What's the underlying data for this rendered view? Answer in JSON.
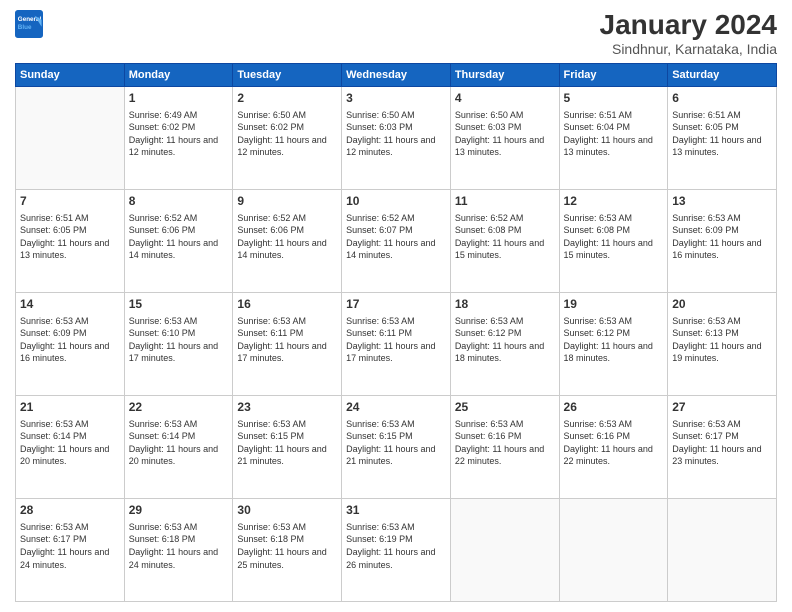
{
  "logo": {
    "line1": "General",
    "line2": "Blue"
  },
  "title": "January 2024",
  "subtitle": "Sindhnur, Karnataka, India",
  "weekdays": [
    "Sunday",
    "Monday",
    "Tuesday",
    "Wednesday",
    "Thursday",
    "Friday",
    "Saturday"
  ],
  "weeks": [
    [
      {
        "day": "",
        "sunrise": "",
        "sunset": "",
        "daylight": ""
      },
      {
        "day": "1",
        "sunrise": "Sunrise: 6:49 AM",
        "sunset": "Sunset: 6:02 PM",
        "daylight": "Daylight: 11 hours and 12 minutes."
      },
      {
        "day": "2",
        "sunrise": "Sunrise: 6:50 AM",
        "sunset": "Sunset: 6:02 PM",
        "daylight": "Daylight: 11 hours and 12 minutes."
      },
      {
        "day": "3",
        "sunrise": "Sunrise: 6:50 AM",
        "sunset": "Sunset: 6:03 PM",
        "daylight": "Daylight: 11 hours and 12 minutes."
      },
      {
        "day": "4",
        "sunrise": "Sunrise: 6:50 AM",
        "sunset": "Sunset: 6:03 PM",
        "daylight": "Daylight: 11 hours and 13 minutes."
      },
      {
        "day": "5",
        "sunrise": "Sunrise: 6:51 AM",
        "sunset": "Sunset: 6:04 PM",
        "daylight": "Daylight: 11 hours and 13 minutes."
      },
      {
        "day": "6",
        "sunrise": "Sunrise: 6:51 AM",
        "sunset": "Sunset: 6:05 PM",
        "daylight": "Daylight: 11 hours and 13 minutes."
      }
    ],
    [
      {
        "day": "7",
        "sunrise": "Sunrise: 6:51 AM",
        "sunset": "Sunset: 6:05 PM",
        "daylight": "Daylight: 11 hours and 13 minutes."
      },
      {
        "day": "8",
        "sunrise": "Sunrise: 6:52 AM",
        "sunset": "Sunset: 6:06 PM",
        "daylight": "Daylight: 11 hours and 14 minutes."
      },
      {
        "day": "9",
        "sunrise": "Sunrise: 6:52 AM",
        "sunset": "Sunset: 6:06 PM",
        "daylight": "Daylight: 11 hours and 14 minutes."
      },
      {
        "day": "10",
        "sunrise": "Sunrise: 6:52 AM",
        "sunset": "Sunset: 6:07 PM",
        "daylight": "Daylight: 11 hours and 14 minutes."
      },
      {
        "day": "11",
        "sunrise": "Sunrise: 6:52 AM",
        "sunset": "Sunset: 6:08 PM",
        "daylight": "Daylight: 11 hours and 15 minutes."
      },
      {
        "day": "12",
        "sunrise": "Sunrise: 6:53 AM",
        "sunset": "Sunset: 6:08 PM",
        "daylight": "Daylight: 11 hours and 15 minutes."
      },
      {
        "day": "13",
        "sunrise": "Sunrise: 6:53 AM",
        "sunset": "Sunset: 6:09 PM",
        "daylight": "Daylight: 11 hours and 16 minutes."
      }
    ],
    [
      {
        "day": "14",
        "sunrise": "Sunrise: 6:53 AM",
        "sunset": "Sunset: 6:09 PM",
        "daylight": "Daylight: 11 hours and 16 minutes."
      },
      {
        "day": "15",
        "sunrise": "Sunrise: 6:53 AM",
        "sunset": "Sunset: 6:10 PM",
        "daylight": "Daylight: 11 hours and 17 minutes."
      },
      {
        "day": "16",
        "sunrise": "Sunrise: 6:53 AM",
        "sunset": "Sunset: 6:11 PM",
        "daylight": "Daylight: 11 hours and 17 minutes."
      },
      {
        "day": "17",
        "sunrise": "Sunrise: 6:53 AM",
        "sunset": "Sunset: 6:11 PM",
        "daylight": "Daylight: 11 hours and 17 minutes."
      },
      {
        "day": "18",
        "sunrise": "Sunrise: 6:53 AM",
        "sunset": "Sunset: 6:12 PM",
        "daylight": "Daylight: 11 hours and 18 minutes."
      },
      {
        "day": "19",
        "sunrise": "Sunrise: 6:53 AM",
        "sunset": "Sunset: 6:12 PM",
        "daylight": "Daylight: 11 hours and 18 minutes."
      },
      {
        "day": "20",
        "sunrise": "Sunrise: 6:53 AM",
        "sunset": "Sunset: 6:13 PM",
        "daylight": "Daylight: 11 hours and 19 minutes."
      }
    ],
    [
      {
        "day": "21",
        "sunrise": "Sunrise: 6:53 AM",
        "sunset": "Sunset: 6:14 PM",
        "daylight": "Daylight: 11 hours and 20 minutes."
      },
      {
        "day": "22",
        "sunrise": "Sunrise: 6:53 AM",
        "sunset": "Sunset: 6:14 PM",
        "daylight": "Daylight: 11 hours and 20 minutes."
      },
      {
        "day": "23",
        "sunrise": "Sunrise: 6:53 AM",
        "sunset": "Sunset: 6:15 PM",
        "daylight": "Daylight: 11 hours and 21 minutes."
      },
      {
        "day": "24",
        "sunrise": "Sunrise: 6:53 AM",
        "sunset": "Sunset: 6:15 PM",
        "daylight": "Daylight: 11 hours and 21 minutes."
      },
      {
        "day": "25",
        "sunrise": "Sunrise: 6:53 AM",
        "sunset": "Sunset: 6:16 PM",
        "daylight": "Daylight: 11 hours and 22 minutes."
      },
      {
        "day": "26",
        "sunrise": "Sunrise: 6:53 AM",
        "sunset": "Sunset: 6:16 PM",
        "daylight": "Daylight: 11 hours and 22 minutes."
      },
      {
        "day": "27",
        "sunrise": "Sunrise: 6:53 AM",
        "sunset": "Sunset: 6:17 PM",
        "daylight": "Daylight: 11 hours and 23 minutes."
      }
    ],
    [
      {
        "day": "28",
        "sunrise": "Sunrise: 6:53 AM",
        "sunset": "Sunset: 6:17 PM",
        "daylight": "Daylight: 11 hours and 24 minutes."
      },
      {
        "day": "29",
        "sunrise": "Sunrise: 6:53 AM",
        "sunset": "Sunset: 6:18 PM",
        "daylight": "Daylight: 11 hours and 24 minutes."
      },
      {
        "day": "30",
        "sunrise": "Sunrise: 6:53 AM",
        "sunset": "Sunset: 6:18 PM",
        "daylight": "Daylight: 11 hours and 25 minutes."
      },
      {
        "day": "31",
        "sunrise": "Sunrise: 6:53 AM",
        "sunset": "Sunset: 6:19 PM",
        "daylight": "Daylight: 11 hours and 26 minutes."
      },
      {
        "day": "",
        "sunrise": "",
        "sunset": "",
        "daylight": ""
      },
      {
        "day": "",
        "sunrise": "",
        "sunset": "",
        "daylight": ""
      },
      {
        "day": "",
        "sunrise": "",
        "sunset": "",
        "daylight": ""
      }
    ]
  ]
}
